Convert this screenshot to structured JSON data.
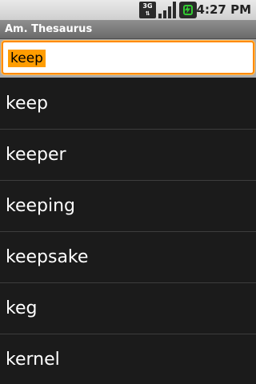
{
  "status_bar": {
    "network_type": "3G",
    "icons": [
      "network-3g-icon",
      "signal-strength-icon",
      "battery-charging-icon"
    ],
    "time": "4:27 PM"
  },
  "app": {
    "title": "Am. Thesaurus"
  },
  "search": {
    "value": "keep",
    "highlight_color": "#ff9d00",
    "focus_border_color": "#ff8a00"
  },
  "results": [
    {
      "label": "keep"
    },
    {
      "label": "keeper"
    },
    {
      "label": "keeping"
    },
    {
      "label": "keepsake"
    },
    {
      "label": "keg"
    },
    {
      "label": "kernel"
    }
  ]
}
